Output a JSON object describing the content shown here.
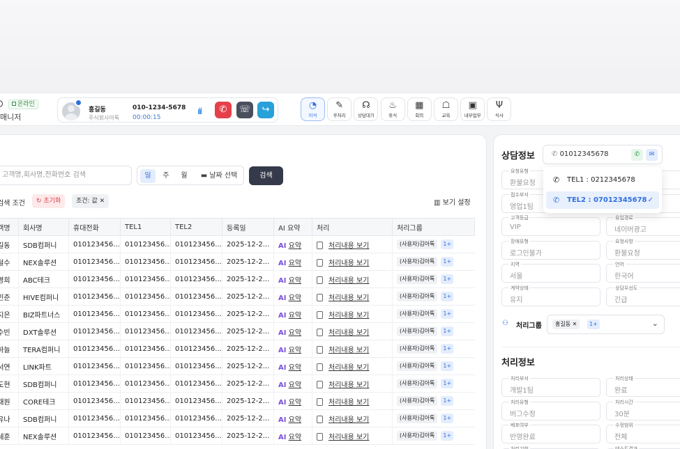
{
  "status": {
    "online": "온라인",
    "manager": "매니저"
  },
  "call": {
    "name": "홍길동",
    "company": "주식회사아톡",
    "number": "010-1234-5678",
    "timer": "00:00:15"
  },
  "toolbar": [
    {
      "label": "이석",
      "icon": "clock-icon"
    },
    {
      "label": "후처리",
      "icon": "edit-icon"
    },
    {
      "label": "상담대기",
      "icon": "headset-icon"
    },
    {
      "label": "휴식",
      "icon": "coffee-icon"
    },
    {
      "label": "회의",
      "icon": "meeting-icon"
    },
    {
      "label": "교육",
      "icon": "education-icon"
    },
    {
      "label": "내부업무",
      "icon": "briefcase-icon"
    },
    {
      "label": "식사",
      "icon": "meal-icon"
    }
  ],
  "search": {
    "placeholder": "고객명,회사명,전화번호 검색",
    "periods": [
      "일",
      "주",
      "월"
    ],
    "date": "날짜 선택",
    "button": "검색",
    "condition_label": "검색 조건",
    "reset": "초기화",
    "chip": "조건: 값",
    "view_settings": "보기 설정"
  },
  "table": {
    "headers": [
      "고객명",
      "회사명",
      "휴대전화",
      "TEL1",
      "TEL2",
      "등록일",
      "AI 요약",
      "처리",
      "처리그룹"
    ],
    "ai_label": "AI",
    "ai_text": "요약",
    "process_text": "처리내용 보기",
    "group_text": "(사용자)김아톡",
    "group_more": "1+",
    "rows": [
      {
        "c": "홍길동",
        "company": "SDB컴퍼니",
        "m": "010123456...",
        "t1": "010123456...",
        "t2": "010123456...",
        "d": "2025-12-2..."
      },
      {
        "c": "김철수",
        "company": "NEX솔루션",
        "m": "010123456...",
        "t1": "010123456...",
        "t2": "010123456...",
        "d": "2025-12-2..."
      },
      {
        "c": "이영희",
        "company": "ABC테크",
        "m": "010123456...",
        "t1": "010123456...",
        "t2": "010123456...",
        "d": "2025-12-2..."
      },
      {
        "c": "박민준",
        "company": "HIVE컴퍼니",
        "m": "010123456...",
        "t1": "010123456...",
        "t2": "010123456...",
        "d": "2025-12-2..."
      },
      {
        "c": "최지은",
        "company": " BIZ파트너스",
        "m": "010123456...",
        "t1": "010123456...",
        "t2": "010123456...",
        "d": "2025-12-2..."
      },
      {
        "c": "정수빈",
        "company": "DXT솔루션",
        "m": "010123456...",
        "t1": "010123456...",
        "t2": "010123456...",
        "d": "2025-12-2..."
      },
      {
        "c": "강하늘",
        "company": "TERA컴퍼니",
        "m": "010123456...",
        "t1": "010123456...",
        "t2": "010123456...",
        "d": "2025-12-2..."
      },
      {
        "c": "윤서연",
        "company": " LINK파트",
        "m": "010123456...",
        "t1": "010123456...",
        "t2": "010123456...",
        "d": "2025-12-2..."
      },
      {
        "c": "장도현",
        "company": "SDB컴퍼니",
        "m": "010123456...",
        "t1": "010123456...",
        "t2": "010123456...",
        "d": "2025-12-2..."
      },
      {
        "c": "임채원",
        "company": "CORE테크",
        "m": "010123456...",
        "t1": "010123456...",
        "t2": "010123456...",
        "d": "2025-12-2..."
      },
      {
        "c": "한유나",
        "company": "SDB컴퍼니",
        "m": "010123456...",
        "t1": "010123456...",
        "t2": "010123456...",
        "d": "2025-12-2..."
      },
      {
        "c": "오세훈",
        "company": "NEX솔루션",
        "m": "010123456...",
        "t1": "010123456...",
        "t2": "010123456...",
        "d": "2025-12-2..."
      }
    ]
  },
  "consult": {
    "title": "상담정보",
    "tel_selected": "01012345678",
    "tel_options": [
      {
        "label": "TEL1 : 0212345678",
        "selected": false
      },
      {
        "label": "TEL2 : 07012345678",
        "selected": true
      }
    ],
    "fields": [
      {
        "label": "요청유형",
        "value": "환불요청"
      },
      {
        "label": "",
        "value": ""
      },
      {
        "label": "접수부서",
        "value": "영업1팀"
      },
      {
        "label": "",
        "value": ""
      },
      {
        "label": "고객등급",
        "value": "VIP"
      },
      {
        "label": "유입경로",
        "value": "네이버광고"
      },
      {
        "label": "장애유형",
        "value": "로그인불가"
      },
      {
        "label": "요청사항",
        "value": "환불요청"
      },
      {
        "label": "지역",
        "value": "서울"
      },
      {
        "label": "언어",
        "value": "한국어"
      },
      {
        "label": "계약상태",
        "value": "유지"
      },
      {
        "label": "상담우선도",
        "value": "긴급"
      }
    ],
    "group_label": "처리그룹",
    "group_chip": "홍길동",
    "group_more": "1+"
  },
  "process": {
    "title": "처리정보",
    "fields": [
      {
        "label": "처리부서",
        "value": "개발1팀"
      },
      {
        "label": "처리상태",
        "value": "완료"
      },
      {
        "label": "처리유형",
        "value": "버그수정"
      },
      {
        "label": "처리시간",
        "value": "30분"
      },
      {
        "label": "배포여부",
        "value": "반영완료"
      },
      {
        "label": "수정범위",
        "value": "전체"
      },
      {
        "label": "처리기한",
        "value": ""
      },
      {
        "label": "테스트결과",
        "value": ""
      }
    ]
  }
}
